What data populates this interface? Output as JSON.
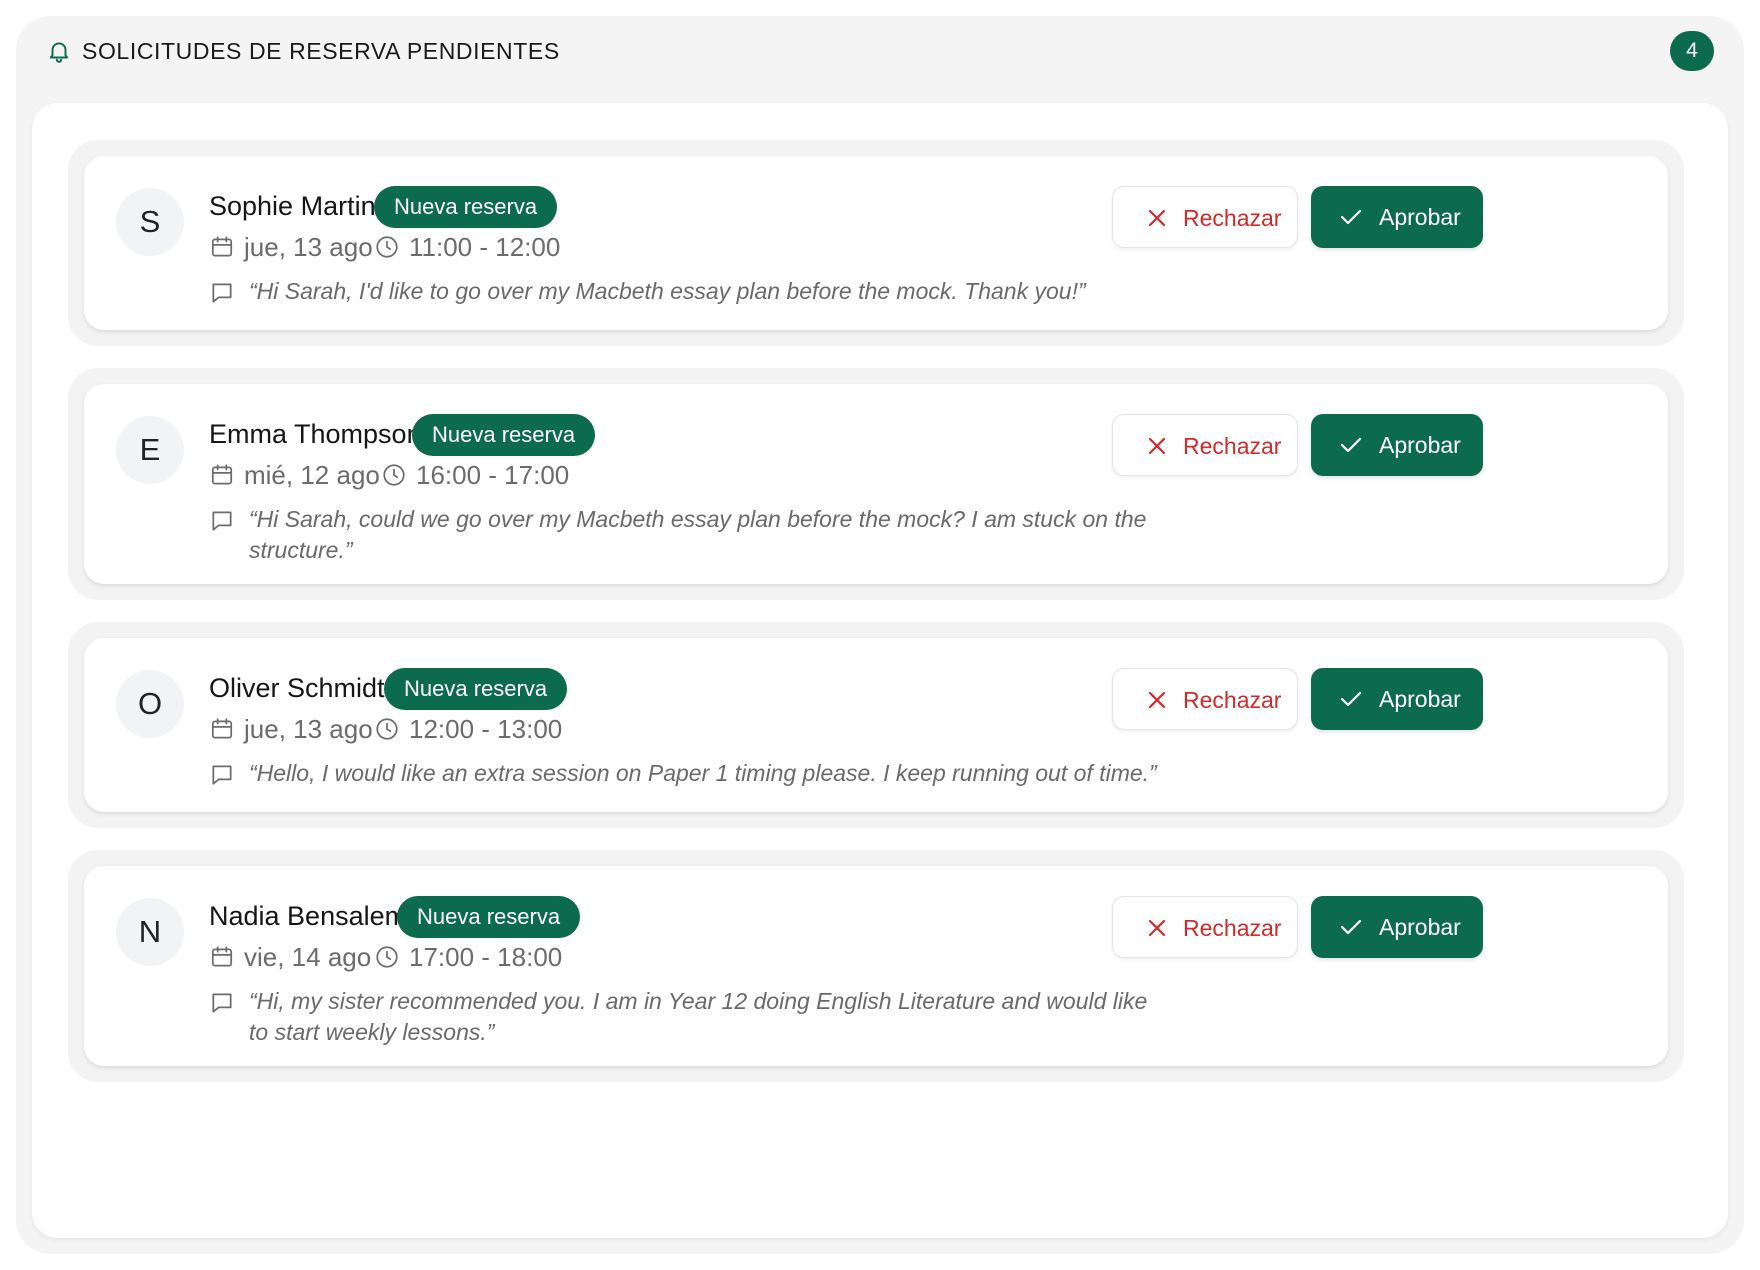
{
  "header": {
    "title": "SOLICITUDES DE RESERVA PENDIENTES",
    "count": "4"
  },
  "requests": [
    {
      "initial": "S",
      "name": "Sophie Martin",
      "tag": "Nueva reserva",
      "date": "jue, 13 ago",
      "time": "11:00 - 12:00",
      "message": "“Hi Sarah, I'd like to go over my Macbeth essay plan before the mock. Thank you!”",
      "reject_label": "Rechazar",
      "approve_label": "Aprobar"
    },
    {
      "initial": "E",
      "name": "Emma Thompson",
      "tag": "Nueva reserva",
      "date": "mié, 12 ago",
      "time": "16:00 - 17:00",
      "message": "“Hi Sarah, could we go over my Macbeth essay plan before the mock? I am stuck on the structure.”",
      "reject_label": "Rechazar",
      "approve_label": "Aprobar"
    },
    {
      "initial": "O",
      "name": "Oliver Schmidt",
      "tag": "Nueva reserva",
      "date": "jue, 13 ago",
      "time": "12:00 - 13:00",
      "message": "“Hello, I would like an extra session on Paper 1 timing please. I keep running out of time.”",
      "reject_label": "Rechazar",
      "approve_label": "Aprobar"
    },
    {
      "initial": "N",
      "name": "Nadia Bensalem",
      "tag": "Nueva reserva",
      "date": "vie, 14 ago",
      "time": "17:00 - 18:00",
      "message": "“Hi, my sister recommended you. I am in Year 12 doing English Literature and would like to start weekly lessons.”",
      "reject_label": "Rechazar",
      "approve_label": "Aprobar"
    }
  ],
  "colors": {
    "accent": "#0c6b4d",
    "reject": "#d02a2a",
    "muted_text": "#6c6c6c"
  },
  "icons": {
    "header": "bell-icon",
    "date": "calendar-icon",
    "time": "clock-icon",
    "message": "chat-bubble-icon",
    "reject": "close-icon",
    "approve": "check-icon"
  }
}
